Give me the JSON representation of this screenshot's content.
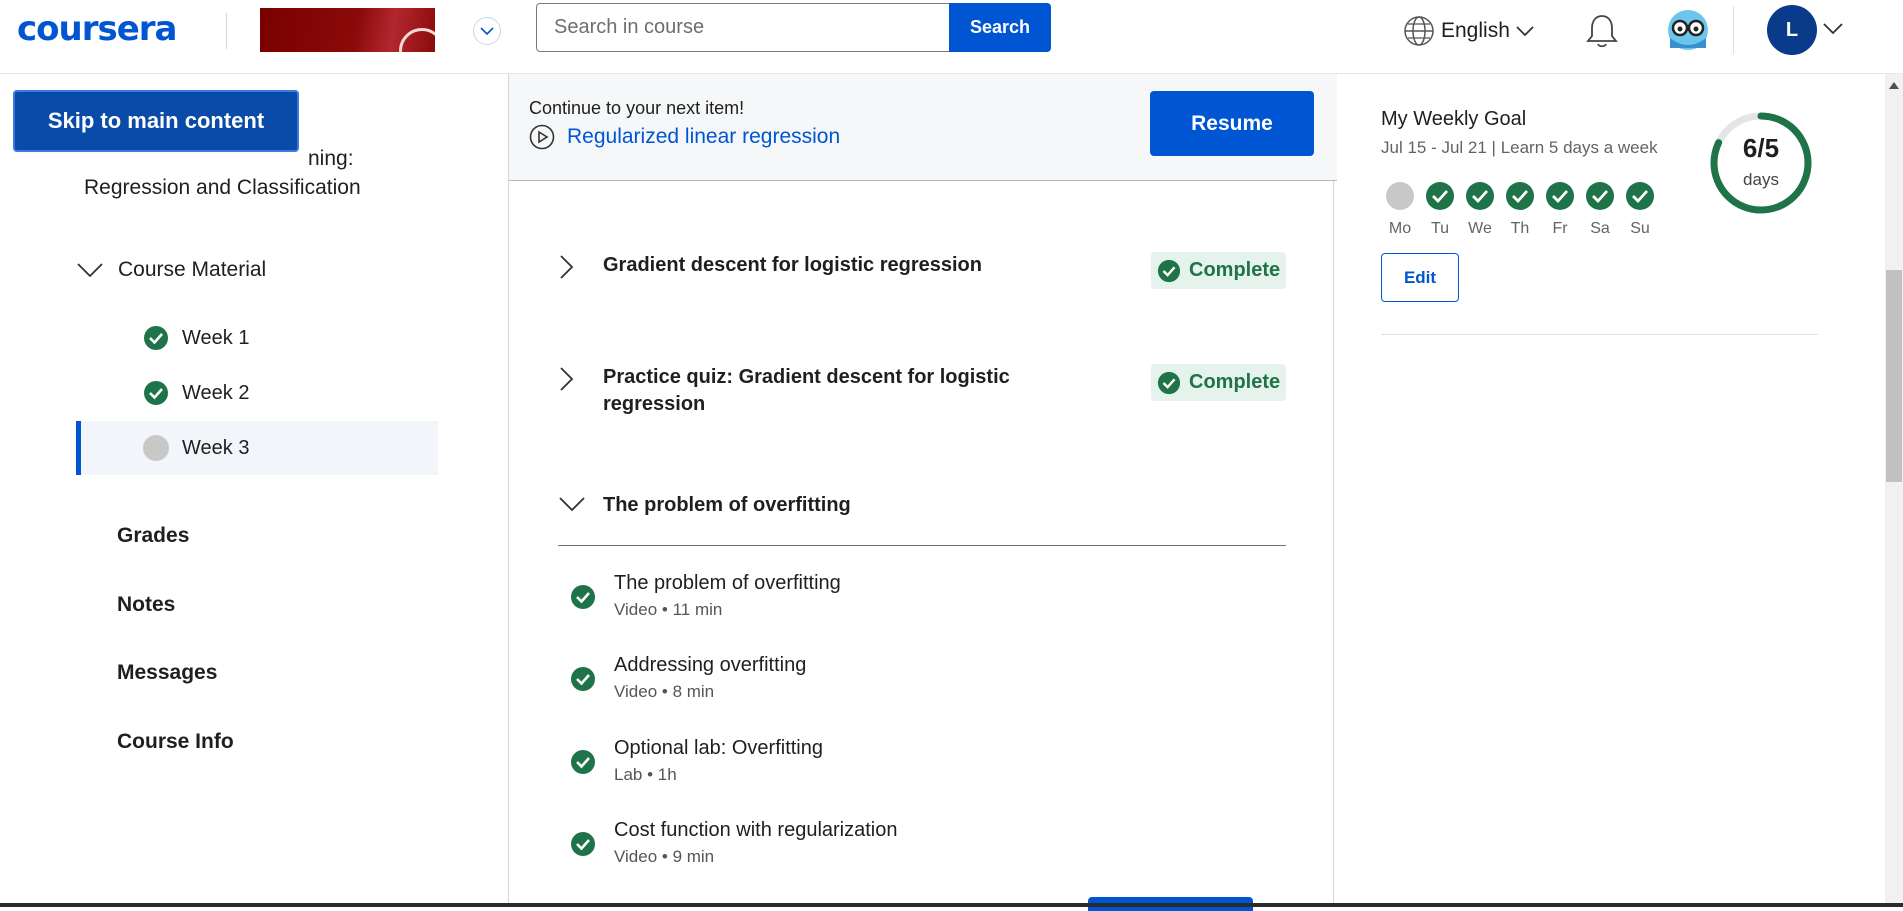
{
  "header": {
    "logo": "coursera",
    "search_placeholder": "Search in course",
    "search_button": "Search",
    "language": "English",
    "user_initial": "L"
  },
  "sidebar": {
    "skip_link": "Skip to main content",
    "course_title_partial": "ning:",
    "course_title_line2": "Regression and Classification",
    "course_material": "Course Material",
    "weeks": [
      {
        "label": "Week 1",
        "status": "complete"
      },
      {
        "label": "Week 2",
        "status": "complete"
      },
      {
        "label": "Week 3",
        "status": "in-progress"
      }
    ],
    "nav": [
      "Grades",
      "Notes",
      "Messages",
      "Course Info"
    ]
  },
  "resume": {
    "caption": "Continue to your next item!",
    "item_title": "Regularized linear regression",
    "button": "Resume"
  },
  "lessons": [
    {
      "title": "Gradient descent for logistic regression",
      "status": "Complete"
    },
    {
      "title": "Practice quiz: Gradient descent for logistic regression",
      "status": "Complete"
    }
  ],
  "section": {
    "title": "The problem of overfitting",
    "items": [
      {
        "name": "The problem of overfitting",
        "meta": "Video • 11 min"
      },
      {
        "name": "Addressing overfitting",
        "meta": "Video • 8 min"
      },
      {
        "name": "Optional lab: Overfitting",
        "meta": "Lab • 1h"
      },
      {
        "name": "Cost function with regularization",
        "meta": "Video • 9 min"
      }
    ]
  },
  "weekly_goal": {
    "title": "My Weekly Goal",
    "subtitle": "Jul 15 - Jul 21 | Learn 5 days a week",
    "days": [
      {
        "label": "Mo",
        "done": false
      },
      {
        "label": "Tu",
        "done": true
      },
      {
        "label": "We",
        "done": true
      },
      {
        "label": "Th",
        "done": true
      },
      {
        "label": "Fr",
        "done": true
      },
      {
        "label": "Sa",
        "done": true
      },
      {
        "label": "Su",
        "done": true
      }
    ],
    "edit_button": "Edit",
    "progress_value": "6/5",
    "progress_unit": "days",
    "progress_fraction": 1.0
  },
  "colors": {
    "brand_blue": "#0056d2",
    "complete_green": "#1e7349",
    "badge_bg": "#e6f2ec",
    "incomplete_gray": "#c8c8c8"
  }
}
